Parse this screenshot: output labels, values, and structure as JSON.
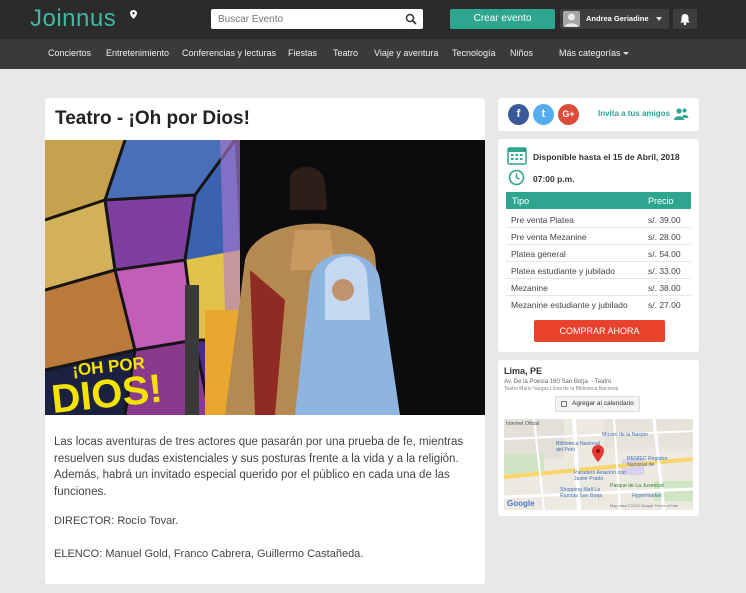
{
  "header": {
    "logo_text": "Joinnus",
    "search_placeholder": "Buscar Evento",
    "create_button": "Crear evento",
    "user_name": "Andrea Geriadine"
  },
  "nav": {
    "items": [
      "Conciertos",
      "Entretenimiento",
      "Conferencias y lecturas",
      "Fiestas",
      "Teatro",
      "Viaje y aventura",
      "Tecnología",
      "Niños",
      "Más categorías"
    ]
  },
  "event": {
    "title": "Teatro - ¡Oh por Dios!",
    "poster_text_line1": "¡OH POR",
    "poster_text_line2": "DIOS!",
    "description": "Las locas aventuras de tres actores que pasarán por una prueba de fe, mientras resuelven sus dudas existenciales y sus posturas frente a la vida y a la religión. Además, habrá un invitado especial querido por el público en cada una de las funciones.",
    "director": "DIRECTOR: Rocío Tovar.",
    "cast": "ELENCO: Manuel Gold, Franco Cabrera, Guillermo Castañeda."
  },
  "social": {
    "facebook": "f",
    "twitter": "t",
    "google": "G+",
    "invite_label": "Invita a tus amigos"
  },
  "tickets": {
    "available_until": "Disponible hasta el 15 de Abril, 2018",
    "time": "07:00 p.m.",
    "col_type": "Tipo",
    "col_price": "Precio",
    "rows": [
      {
        "type": "Pre venta Platea",
        "price": "s/. 39.00"
      },
      {
        "type": "Pre venta Mezanine",
        "price": "s/. 28.00"
      },
      {
        "type": "Platea general",
        "price": "s/. 54.00"
      },
      {
        "type": "Platea estudiante y jubilado",
        "price": "s/. 33.00"
      },
      {
        "type": "Mezanine",
        "price": "s/. 38.00"
      },
      {
        "type": "Mezanine estudiante y jubilado",
        "price": "s/. 27.00"
      }
    ],
    "buy_button": "COMPRAR AHORA"
  },
  "location": {
    "city": "Lima, PE",
    "address": "Av. De la Poesía 160 San Borja. - Teatro",
    "venue": "Teatro Mario Vargas Llosa de la Biblioteca Nacional",
    "calendar_button": "Agregar al calendario",
    "map_labels": {
      "museo": "Museo de la Nación",
      "biblioteca": "Biblioteca Nacional del Perú",
      "reniec": "RENIEC Registro Nacional de",
      "paradero": "Paradero Aviación con Javier Prado",
      "shopping": "Shopping Mall La Rambla San Borja",
      "parque": "Parque de La Juventud",
      "hypermarket": "Hypermarket",
      "street": "Internet Oficial",
      "google": "Google",
      "terms": "Map data ©2018 Google   Terms of Use"
    }
  }
}
